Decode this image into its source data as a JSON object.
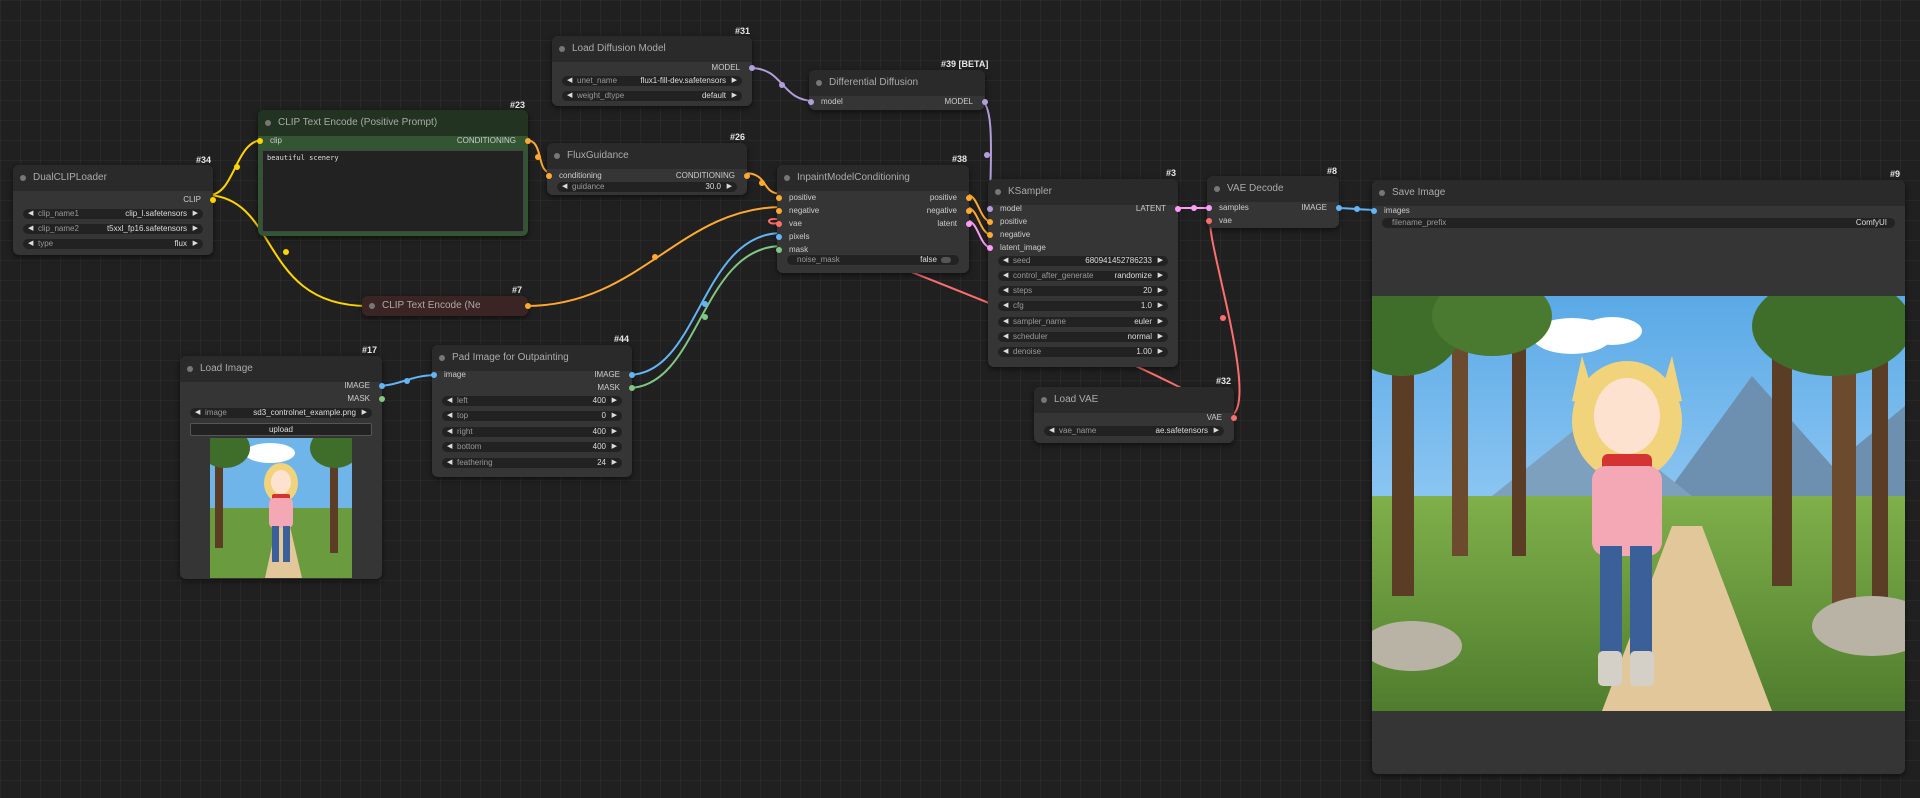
{
  "nodes": {
    "dualclip": {
      "id": "#34",
      "title": "DualCLIPLoader",
      "out_clip": "CLIP",
      "clip_name1_label": "clip_name1",
      "clip_name1": "clip_l.safetensors",
      "clip_name2_label": "clip_name2",
      "clip_name2": "t5xxl_fp16.safetensors",
      "type_label": "type",
      "type": "flux"
    },
    "clip_pos": {
      "id": "#23",
      "title": "CLIP Text Encode (Positive Prompt)",
      "in_clip": "clip",
      "out": "CONDITIONING",
      "text": "beautiful scenery"
    },
    "clip_neg": {
      "id": "#7",
      "title": "CLIP Text Encode (Ne"
    },
    "load_diff": {
      "id": "#31",
      "title": "Load Diffusion Model",
      "out": "MODEL",
      "unet_label": "unet_name",
      "unet": "flux1-fill-dev.safetensors",
      "wdtype_label": "weight_dtype",
      "wdtype": "default"
    },
    "flux_guid": {
      "id": "#26",
      "title": "FluxGuidance",
      "in": "conditioning",
      "out": "CONDITIONING",
      "guidance_label": "guidance",
      "guidance": "30.0"
    },
    "diff_diff": {
      "id": "#39 [BETA]",
      "title": "Differential Diffusion",
      "in": "model",
      "out": "MODEL"
    },
    "inpaint": {
      "id": "#38",
      "title": "InpaintModelConditioning",
      "in_positive": "positive",
      "in_negative": "negative",
      "in_vae": "vae",
      "in_pixels": "pixels",
      "in_mask": "mask",
      "out_positive": "positive",
      "out_negative": "negative",
      "out_latent": "latent",
      "noise_mask_label": "noise_mask",
      "noise_mask": "false"
    },
    "ksampler": {
      "id": "#3",
      "title": "KSampler",
      "out": "LATENT",
      "in_model": "model",
      "in_positive": "positive",
      "in_negative": "negative",
      "in_latent": "latent_image",
      "seed_label": "seed",
      "seed": "680941452786233",
      "cag_label": "control_after_generate",
      "cag": "randomize",
      "steps_label": "steps",
      "steps": "20",
      "cfg_label": "cfg",
      "cfg": "1.0",
      "sampler_label": "sampler_name",
      "sampler": "euler",
      "scheduler_label": "scheduler",
      "scheduler": "normal",
      "denoise_label": "denoise",
      "denoise": "1.00"
    },
    "vae_decode": {
      "id": "#8",
      "title": "VAE Decode",
      "in_samples": "samples",
      "in_vae": "vae",
      "out": "IMAGE"
    },
    "save_image": {
      "id": "#9",
      "title": "Save Image",
      "in": "images",
      "prefix_label": "filename_prefix",
      "prefix": "ComfyUI"
    },
    "load_image": {
      "id": "#17",
      "title": "Load Image",
      "out_image": "IMAGE",
      "out_mask": "MASK",
      "image_label": "image",
      "image": "sd3_controlnet_example.png",
      "upload": "upload"
    },
    "pad_image": {
      "id": "#44",
      "title": "Pad Image for Outpainting",
      "in": "image",
      "out_image": "IMAGE",
      "out_mask": "MASK",
      "left_label": "left",
      "left": "400",
      "top_label": "top",
      "top": "0",
      "right_label": "right",
      "right": "400",
      "bottom_label": "bottom",
      "bottom": "400",
      "feather_label": "feathering",
      "feather": "24"
    },
    "load_vae": {
      "id": "#32",
      "title": "Load VAE",
      "out": "VAE",
      "vae_label": "vae_name",
      "vae": "ae.safetensors"
    }
  },
  "colors": {
    "clip": "#ffd500",
    "conditioning": "#ffa931",
    "model": "#b39ddb",
    "vae": "#ff6e6e",
    "image": "#64b5f6",
    "mask": "#81c784",
    "latent": "#ff9cf9"
  }
}
